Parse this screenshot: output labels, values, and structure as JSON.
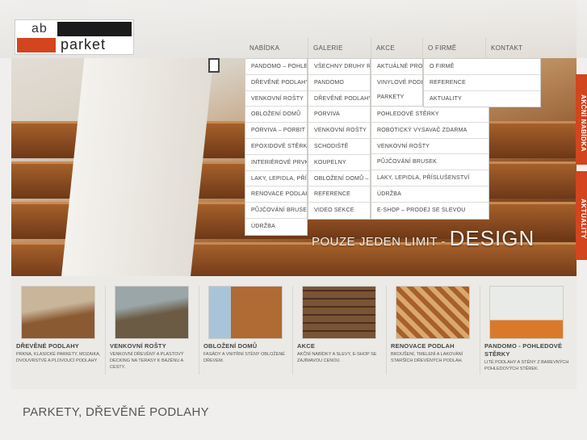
{
  "brand": {
    "logo_top": "ab",
    "logo_bottom": "parket"
  },
  "hero": {
    "slogan_small": "POUZE JEDEN LIMIT - ",
    "slogan_big": "DESIGN"
  },
  "nav": [
    {
      "label": "NABÍDKA"
    },
    {
      "label": "GALERIE"
    },
    {
      "label": "AKCE"
    },
    {
      "label": "O FIRMĚ"
    },
    {
      "label": "KONTAKT"
    }
  ],
  "menus": {
    "nabidka": [
      "PANDOMO – POHLEDOVÉ",
      "DŘEVĚNÉ PODLAHY",
      "VENKOVNÍ ROŠTY",
      "OBLOŽENÍ DOMŮ",
      "PORVIVA – PORBIT S",
      "EPOXIDOVÉ STĚRKY",
      "INTERIÉROVÉ PRVKY",
      "LAKY, LEPIDLA, PŘÍS",
      "RENOVACE PODLAH",
      "PŮJČOVÁNÍ BRUSEK",
      "ÚDRŽBA"
    ],
    "galerie": [
      "VŠECHNY DRUHY REAL",
      "PANDOMO",
      "DŘEVĚNÉ PODLAHY",
      "PORVIVA",
      "VENKOVNÍ ROŠTY",
      "SCHODIŠTĚ",
      "KOUPELNY",
      "OBLOŽENÍ DOMŮ – F",
      "REFERENCE",
      "VIDEO SEKCE"
    ],
    "akce": [
      "AKTUÁLNÉ PROB",
      "VINYLOVÉ PODLA",
      "PARKETY",
      "POHLEDOVÉ STĚRKY",
      "ROBOTICKÝ VYSAVAČ ZDARMA",
      "VENKOVNÍ ROŠTY",
      "PŮJČOVÁNÍ BRUSEK",
      "LAKY, LEPIDLA, PŘÍSLUŠENSTVÍ",
      "ÚDRŽBA",
      "E-SHOP – PRODEJ SE SLEVOU"
    ],
    "ofirme": [
      "O FIRMĚ",
      "REFERENCE",
      "AKTUALITY"
    ]
  },
  "side_tabs": [
    "AKČNÍ NABÍDKA",
    "AKTUALITY"
  ],
  "products": [
    {
      "title": "DŘEVĚNÉ PODLAHY",
      "desc": "PRKNA, KLASICKÉ PARKETY, MOZAIKA, DVOUVRSTVÉ A PLOVOUCÍ PODLAHY",
      "thumb_colors": [
        "#c9b59a",
        "#8a5a32"
      ]
    },
    {
      "title": "VENKOVNÍ ROŠTY",
      "desc": "VENKOVNÍ DŘEVĚNÝ A PLASTOVÝ DECKING NA TERASY K BAZÉNU A CESTY.",
      "thumb_colors": [
        "#9aa6a8",
        "#6b5a44"
      ]
    },
    {
      "title": "OBLOŽENÍ DOMŮ",
      "desc": "FASÁDY A VNITŘNÍ STĚNY OBLOŽENÉ DŘEVEM.",
      "thumb_colors": [
        "#a9c4d8",
        "#b06a33"
      ]
    },
    {
      "title": "AKCE",
      "desc": "AKČNÍ NABÍDKY A SLEVY, E-SHOP SE ZAJÍMAVOU CENOU.",
      "thumb_colors": [
        "#7a5434",
        "#4a3020"
      ]
    },
    {
      "title": "RENOVACE PODLAH",
      "desc": "BROUŠENÍ, TMELENÍ A LAKOVÁNÍ STARŠÍCH DŘEVĚNÝCH PODLAH.",
      "thumb_colors": [
        "#d9a870",
        "#a8602a"
      ]
    },
    {
      "title": "PANDOMO - POHLEDOVÉ STĚRKY",
      "desc": "LITÉ PODLAHY A STĚNY Z BAREVNÝCH POHLEDOVÝCH STĚREK.",
      "thumb_colors": [
        "#e8ebe8",
        "#d97a2a"
      ]
    }
  ],
  "page_title": "PARKETY, DŘEVĚNÉ PODLAHY",
  "colors": {
    "accent": "#d2451e",
    "dark": "#1b1b1b",
    "bg": "#f0efed"
  }
}
